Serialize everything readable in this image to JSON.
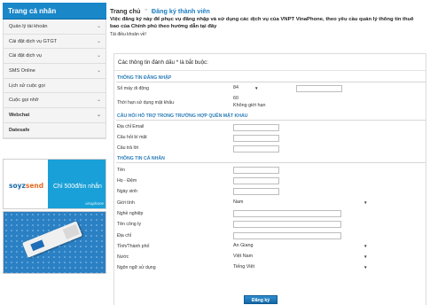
{
  "sidebar": {
    "title": "Trang cá nhân",
    "items": [
      {
        "label": "Quản lý tài khoản"
      },
      {
        "label": "Cài đặt dịch vụ GTGT"
      },
      {
        "label": "Cài đặt dịch vụ"
      },
      {
        "label": "SMS Online"
      },
      {
        "label": "Lịch sử cuộc gọi"
      },
      {
        "label": "Cuộc gọi nhỡ"
      },
      {
        "label": "Webchat"
      },
      {
        "label": "Datesafe"
      }
    ]
  },
  "banners": {
    "sms_logo": "soyzsend",
    "sms_price": "Chỉ 500đ/tin nhắn",
    "sms_brand": "vinaphone"
  },
  "breadcrumb": {
    "home": "Trang chủ",
    "separator": "\"",
    "current": "Đăng ký thành viên"
  },
  "intro_text": "Việc đăng ký này để phục vụ đăng nhập và sử dụng các dịch vụ của VNPT VinaPhone, theo yêu cầu quản lý thông tin thuê bao của Chính phủ theo hướng dẫn tại đây",
  "download_link": "Tải điều khoản về!",
  "form": {
    "required_note": "Các thông tin đánh dấu * là bắt buộc:",
    "login_section": "THÔNG TIN ĐĂNG NHẬP",
    "phone_label": "Số máy di động",
    "phone_prefix": "84",
    "validity_label": "Thời hạn sử dụng mật khẩu",
    "validity_value": "60",
    "validity_option": "Không giới hạn",
    "recovery_section": "CÂU HỎI HỖ TRỢ TRONG TRƯỜNG HỢP QUÊN MẬT KHẨU",
    "email_label": "Địa chỉ Email",
    "question_label": "Câu hỏi bí mật",
    "answer_label": "Câu trả lời",
    "personal_section": "THÔNG TIN CÁ NHÂN",
    "name_label": "Tên",
    "surname_label": "Họ - Đệm",
    "birthday_label": "Ngày sinh",
    "gender_label": "Giới tính",
    "gender_value": "Nam",
    "job_label": "Nghề nghiệp",
    "company_label": "Tên công ty",
    "address_label": "Địa chỉ",
    "province_label": "Tỉnh/Thành phố",
    "province_value": "An Giang",
    "country_label": "Nước",
    "country_value": "Việt Nam",
    "language_label": "Ngôn ngữ sử dụng",
    "language_value": "Tiếng Việt",
    "submit_label": "Đăng ký"
  }
}
